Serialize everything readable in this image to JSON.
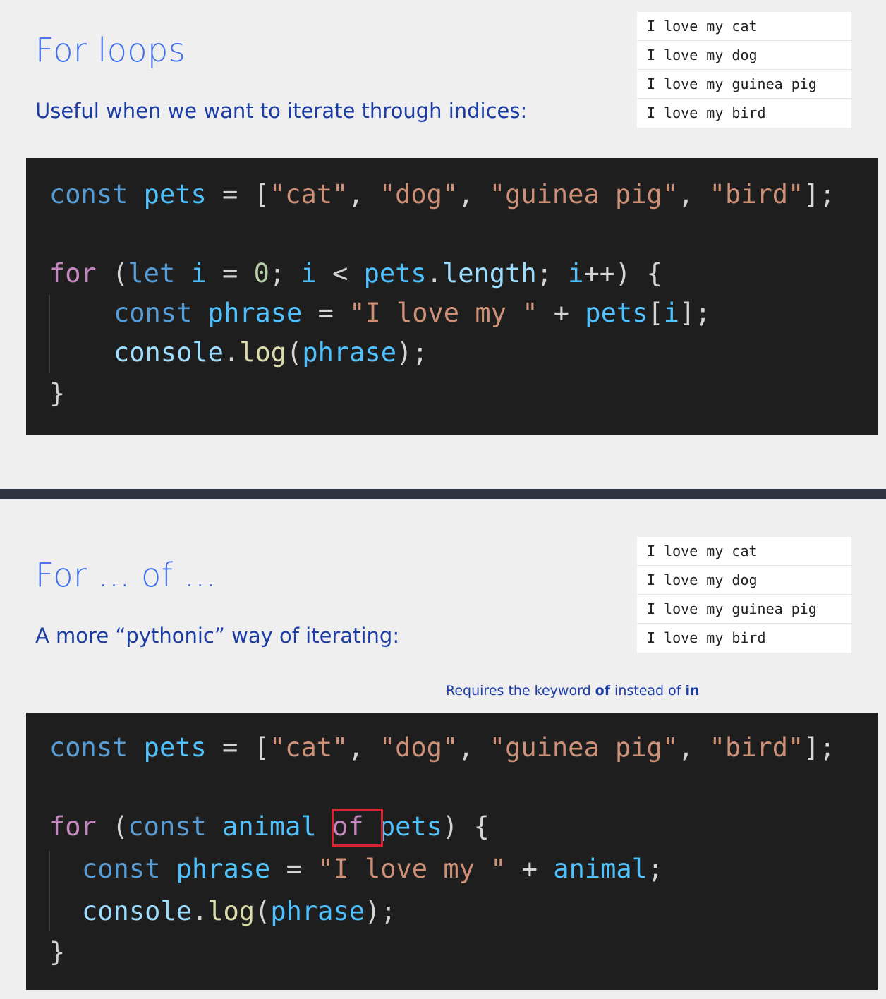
{
  "slide1": {
    "title": "For loops",
    "subtitle": "Useful when we want to iterate through indices:",
    "console": [
      "I love my cat",
      "I love my dog",
      "I love my guinea pig",
      "I love my bird"
    ],
    "code": {
      "l1": {
        "kw": "const",
        "var": "pets",
        "eq": " = ",
        "open": "[",
        "s1": "\"cat\"",
        "c1": ", ",
        "s2": "\"dog\"",
        "c2": ", ",
        "s3": "\"guinea pig\"",
        "c3": ", ",
        "s4": "\"bird\"",
        "close": "];"
      },
      "l2": {
        "for": "for",
        "p": " (",
        "let": "let",
        "i1": " i",
        "eq": " = ",
        "zero": "0",
        "semi": "; ",
        "i2": "i",
        "lt": " < ",
        "pets": "pets",
        "dot": ".",
        "len": "length",
        "semi2": "; ",
        "i3": "i",
        "inc": "++",
        "close": ") {"
      },
      "l3": {
        "kw": "const",
        "phrase": " phrase",
        "eq": " = ",
        "str": "\"I love my \"",
        "plus": " + ",
        "pets": "pets",
        "ob": "[",
        "i": "i",
        "cb": "];"
      },
      "l4": {
        "console": "console",
        "dot": ".",
        "log": "log",
        "op": "(",
        "phrase": "phrase",
        "cp": ");"
      },
      "l5": "}"
    }
  },
  "slide2": {
    "title": "For … of …",
    "subtitle": "A more “pythonic” way of iterating:",
    "console": [
      "I love my cat",
      "I love my dog",
      "I love my guinea pig",
      "I love my bird"
    ],
    "note": {
      "pre": "Requires the keyword ",
      "b1": "of",
      "mid": " instead of ",
      "b2": "in"
    },
    "code": {
      "l1": {
        "kw": "const",
        "var": "pets",
        "eq": " = ",
        "open": "[",
        "s1": "\"cat\"",
        "c1": ", ",
        "s2": "\"dog\"",
        "c2": ", ",
        "s3": "\"guinea pig\"",
        "c3": ", ",
        "s4": "\"bird\"",
        "close": "];"
      },
      "l2": {
        "for": "for",
        "p": " (",
        "const": "const",
        "animal": " animal ",
        "of": "of",
        "pets": " pets",
        "close": ") {"
      },
      "l3": {
        "kw": "const",
        "phrase": " phrase",
        "eq": " = ",
        "str": "\"I love my \"",
        "plus": " + ",
        "animal": "animal",
        "semi": ";"
      },
      "l4": {
        "console": "console",
        "dot": ".",
        "log": "log",
        "op": "(",
        "phrase": "phrase",
        "cp": ");"
      },
      "l5": "}"
    }
  }
}
